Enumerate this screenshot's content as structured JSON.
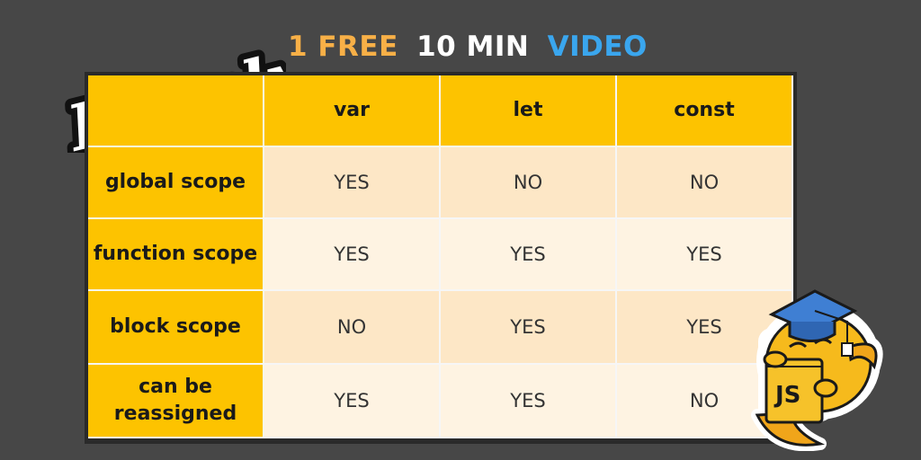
{
  "logo": {
    "text": "Deeply."
  },
  "headline": {
    "part1": "1 FREE",
    "part2": "10 MIN",
    "part3": "VIDEO",
    "colors": {
      "part1": "#f8b047",
      "part2": "#ffffff",
      "part3": "#3aa6ee"
    }
  },
  "table": {
    "headers": [
      "",
      "var",
      "let",
      "const"
    ],
    "rows": [
      {
        "label": "global scope",
        "values": [
          "YES",
          "NO",
          "NO"
        ]
      },
      {
        "label": "function scope",
        "values": [
          "YES",
          "YES",
          "YES"
        ]
      },
      {
        "label": "block scope",
        "values": [
          "NO",
          "YES",
          "YES"
        ]
      },
      {
        "label": "can be reassigned",
        "values": [
          "YES",
          "YES",
          "NO"
        ]
      }
    ]
  },
  "mascot": {
    "badge_text": "JS",
    "icon": "js-mascot-graduate-icon"
  },
  "colors": {
    "gold": "#fdc300",
    "background": "#474747",
    "row_dark": "#fde7c6",
    "row_light": "#fef3e2"
  }
}
